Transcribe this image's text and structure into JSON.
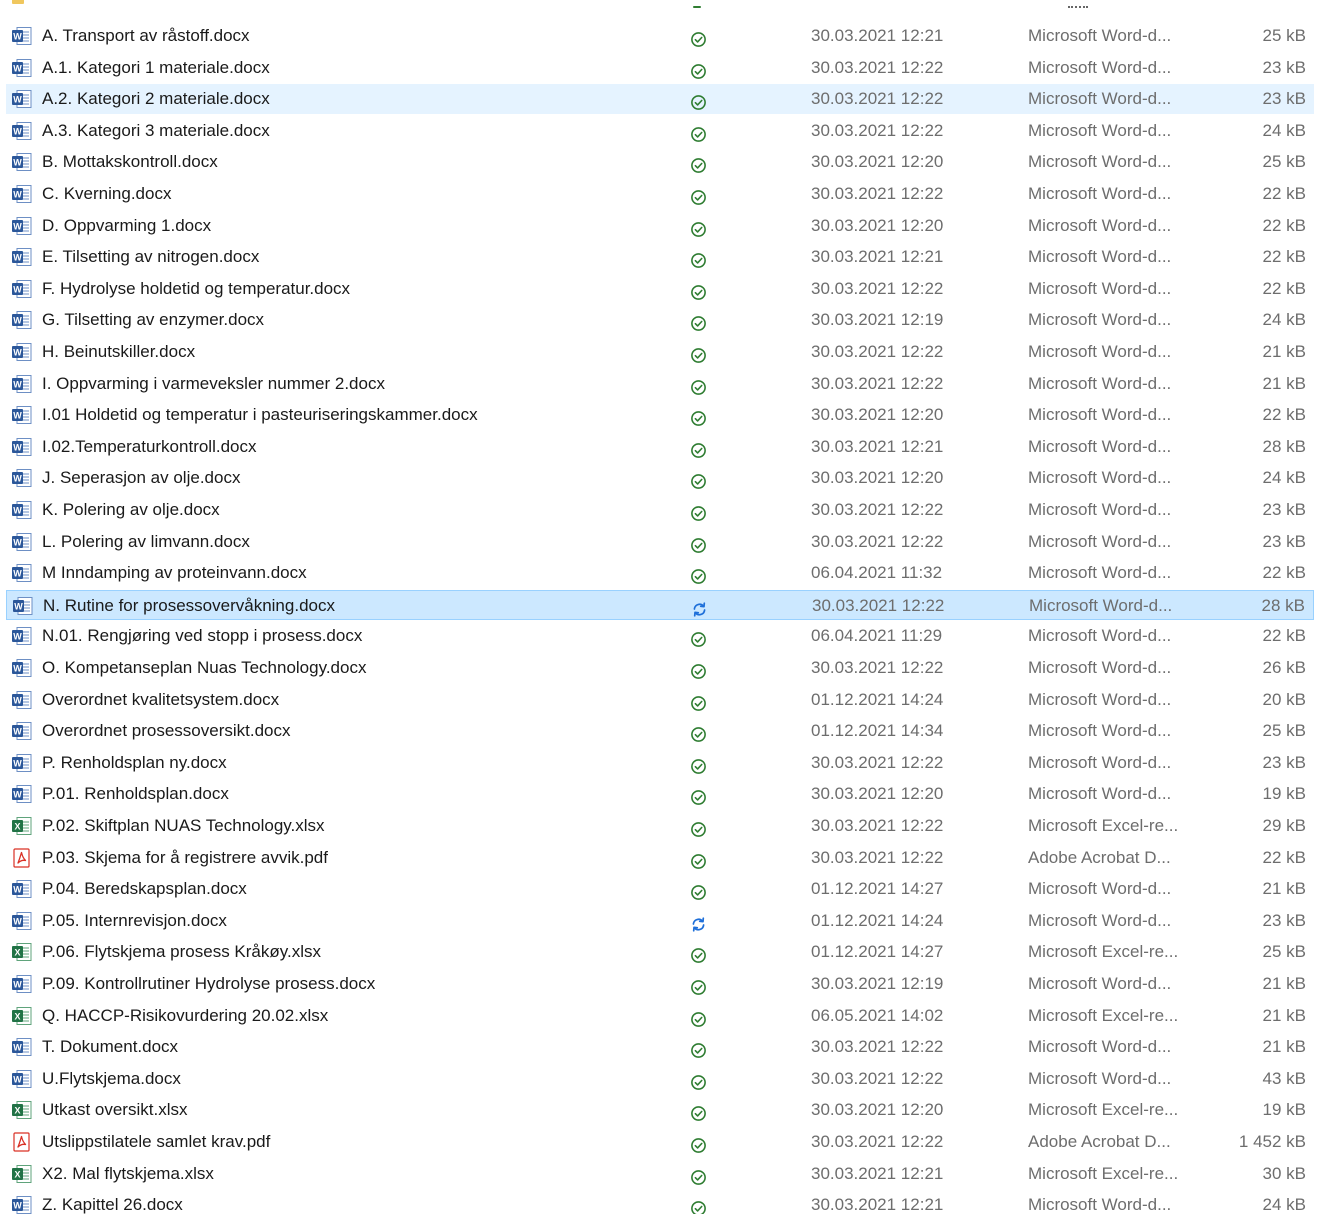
{
  "colors": {
    "word": "#2b579a",
    "excel": "#217346",
    "pdf": "#d93025",
    "synced": "#2f7d32",
    "syncing": "#1e6fd9",
    "hover_bg": "#e5f3ff",
    "selected_bg": "#cce8ff"
  },
  "files": [
    {
      "name": "A. Transport av råstoff.docx",
      "type_icon": "word-icon",
      "status": "synced",
      "date": "30.03.2021 12:21",
      "type": "Microsoft Word-d...",
      "size": "25 kB"
    },
    {
      "name": "A.1. Kategori 1 materiale.docx",
      "type_icon": "word-icon",
      "status": "synced",
      "date": "30.03.2021 12:22",
      "type": "Microsoft Word-d...",
      "size": "23 kB"
    },
    {
      "name": "A.2. Kategori 2 materiale.docx",
      "type_icon": "word-icon",
      "status": "synced",
      "date": "30.03.2021 12:22",
      "type": "Microsoft Word-d...",
      "size": "23 kB",
      "state": "hover"
    },
    {
      "name": "A.3. Kategori 3 materiale.docx",
      "type_icon": "word-icon",
      "status": "synced",
      "date": "30.03.2021 12:22",
      "type": "Microsoft Word-d...",
      "size": "24 kB"
    },
    {
      "name": "B. Mottakskontroll.docx",
      "type_icon": "word-icon",
      "status": "synced",
      "date": "30.03.2021 12:20",
      "type": "Microsoft Word-d...",
      "size": "25 kB"
    },
    {
      "name": "C. Kverning.docx",
      "type_icon": "word-icon",
      "status": "synced",
      "date": "30.03.2021 12:22",
      "type": "Microsoft Word-d...",
      "size": "22 kB"
    },
    {
      "name": "D. Oppvarming 1.docx",
      "type_icon": "word-icon",
      "status": "synced",
      "date": "30.03.2021 12:20",
      "type": "Microsoft Word-d...",
      "size": "22 kB"
    },
    {
      "name": "E. Tilsetting av nitrogen.docx",
      "type_icon": "word-icon",
      "status": "synced",
      "date": "30.03.2021 12:21",
      "type": "Microsoft Word-d...",
      "size": "22 kB"
    },
    {
      "name": "F. Hydrolyse holdetid og temperatur.docx",
      "type_icon": "word-icon",
      "status": "synced",
      "date": "30.03.2021 12:22",
      "type": "Microsoft Word-d...",
      "size": "22 kB"
    },
    {
      "name": "G. Tilsetting av enzymer.docx",
      "type_icon": "word-icon",
      "status": "synced",
      "date": "30.03.2021 12:19",
      "type": "Microsoft Word-d...",
      "size": "24 kB"
    },
    {
      "name": "H. Beinutskiller.docx",
      "type_icon": "word-icon",
      "status": "synced",
      "date": "30.03.2021 12:22",
      "type": "Microsoft Word-d...",
      "size": "21 kB"
    },
    {
      "name": "I. Oppvarming i varmeveksler nummer 2.docx",
      "type_icon": "word-icon",
      "status": "synced",
      "date": "30.03.2021 12:22",
      "type": "Microsoft Word-d...",
      "size": "21 kB"
    },
    {
      "name": "I.01 Holdetid og temperatur i pasteuriseringskammer.docx",
      "type_icon": "word-icon",
      "status": "synced",
      "date": "30.03.2021 12:20",
      "type": "Microsoft Word-d...",
      "size": "22 kB"
    },
    {
      "name": "I.02.Temperaturkontroll.docx",
      "type_icon": "word-icon",
      "status": "synced",
      "date": "30.03.2021 12:21",
      "type": "Microsoft Word-d...",
      "size": "28 kB"
    },
    {
      "name": "J. Seperasjon av olje.docx",
      "type_icon": "word-icon",
      "status": "synced",
      "date": "30.03.2021 12:20",
      "type": "Microsoft Word-d...",
      "size": "24 kB"
    },
    {
      "name": "K. Polering av olje.docx",
      "type_icon": "word-icon",
      "status": "synced",
      "date": "30.03.2021 12:22",
      "type": "Microsoft Word-d...",
      "size": "23 kB"
    },
    {
      "name": "L. Polering av limvann.docx",
      "type_icon": "word-icon",
      "status": "synced",
      "date": "30.03.2021 12:22",
      "type": "Microsoft Word-d...",
      "size": "23 kB"
    },
    {
      "name": "M Inndamping av proteinvann.docx",
      "type_icon": "word-icon",
      "status": "synced",
      "date": "06.04.2021 11:32",
      "type": "Microsoft Word-d...",
      "size": "22 kB"
    },
    {
      "name": "N. Rutine for prosessovervåkning.docx",
      "type_icon": "word-icon",
      "status": "syncing",
      "date": "30.03.2021 12:22",
      "type": "Microsoft Word-d...",
      "size": "28 kB",
      "state": "selected"
    },
    {
      "name": "N.01. Rengjøring ved stopp i prosess.docx",
      "type_icon": "word-icon",
      "status": "synced",
      "date": "06.04.2021 11:29",
      "type": "Microsoft Word-d...",
      "size": "22 kB"
    },
    {
      "name": "O. Kompetanseplan Nuas Technology.docx",
      "type_icon": "word-icon",
      "status": "synced",
      "date": "30.03.2021 12:22",
      "type": "Microsoft Word-d...",
      "size": "26 kB"
    },
    {
      "name": "Overordnet kvalitetsystem.docx",
      "type_icon": "word-icon",
      "status": "synced",
      "date": "01.12.2021 14:24",
      "type": "Microsoft Word-d...",
      "size": "20 kB"
    },
    {
      "name": "Overordnet prosessoversikt.docx",
      "type_icon": "word-icon",
      "status": "synced",
      "date": "01.12.2021 14:34",
      "type": "Microsoft Word-d...",
      "size": "25 kB"
    },
    {
      "name": "P. Renholdsplan ny.docx",
      "type_icon": "word-icon",
      "status": "synced",
      "date": "30.03.2021 12:22",
      "type": "Microsoft Word-d...",
      "size": "23 kB"
    },
    {
      "name": "P.01. Renholdsplan.docx",
      "type_icon": "word-icon",
      "status": "synced",
      "date": "30.03.2021 12:20",
      "type": "Microsoft Word-d...",
      "size": "19 kB"
    },
    {
      "name": "P.02. Skiftplan NUAS Technology.xlsx",
      "type_icon": "excel-icon",
      "status": "synced",
      "date": "30.03.2021 12:22",
      "type": "Microsoft Excel-re...",
      "size": "29 kB"
    },
    {
      "name": "P.03. Skjema for å registrere avvik.pdf",
      "type_icon": "pdf-icon",
      "status": "synced",
      "date": "30.03.2021 12:22",
      "type": "Adobe Acrobat D...",
      "size": "22 kB"
    },
    {
      "name": "P.04. Beredskapsplan.docx",
      "type_icon": "word-icon",
      "status": "synced",
      "date": "01.12.2021 14:27",
      "type": "Microsoft Word-d...",
      "size": "21 kB"
    },
    {
      "name": "P.05. Internrevisjon.docx",
      "type_icon": "word-icon",
      "status": "syncing",
      "date": "01.12.2021 14:24",
      "type": "Microsoft Word-d...",
      "size": "23 kB"
    },
    {
      "name": "P.06. Flytskjema prosess Kråkøy.xlsx",
      "type_icon": "excel-icon",
      "status": "synced",
      "date": "01.12.2021 14:27",
      "type": "Microsoft Excel-re...",
      "size": "25 kB"
    },
    {
      "name": "P.09. Kontrollrutiner Hydrolyse prosess.docx",
      "type_icon": "word-icon",
      "status": "synced",
      "date": "30.03.2021 12:19",
      "type": "Microsoft Word-d...",
      "size": "21 kB"
    },
    {
      "name": "Q. HACCP-Risikovurdering 20.02.xlsx",
      "type_icon": "excel-icon",
      "status": "synced",
      "date": "06.05.2021 14:02",
      "type": "Microsoft Excel-re...",
      "size": "21 kB"
    },
    {
      "name": "T. Dokument.docx",
      "type_icon": "word-icon",
      "status": "synced",
      "date": "30.03.2021 12:22",
      "type": "Microsoft Word-d...",
      "size": "21 kB"
    },
    {
      "name": "U.Flytskjema.docx",
      "type_icon": "word-icon",
      "status": "synced",
      "date": "30.03.2021 12:22",
      "type": "Microsoft Word-d...",
      "size": "43 kB"
    },
    {
      "name": "Utkast oversikt.xlsx",
      "type_icon": "excel-icon",
      "status": "synced",
      "date": "30.03.2021 12:20",
      "type": "Microsoft Excel-re...",
      "size": "19 kB"
    },
    {
      "name": "Utslippstilatele samlet krav.pdf",
      "type_icon": "pdf-icon",
      "status": "synced",
      "date": "30.03.2021 12:22",
      "type": "Adobe Acrobat D...",
      "size": "1 452 kB"
    },
    {
      "name": "X2. Mal flytskjema.xlsx",
      "type_icon": "excel-icon",
      "status": "synced",
      "date": "30.03.2021 12:21",
      "type": "Microsoft Excel-re...",
      "size": "30 kB"
    },
    {
      "name": "Z. Kapittel 26.docx",
      "type_icon": "word-icon",
      "status": "synced",
      "date": "30.03.2021 12:21",
      "type": "Microsoft Word-d...",
      "size": "24 kB"
    }
  ]
}
